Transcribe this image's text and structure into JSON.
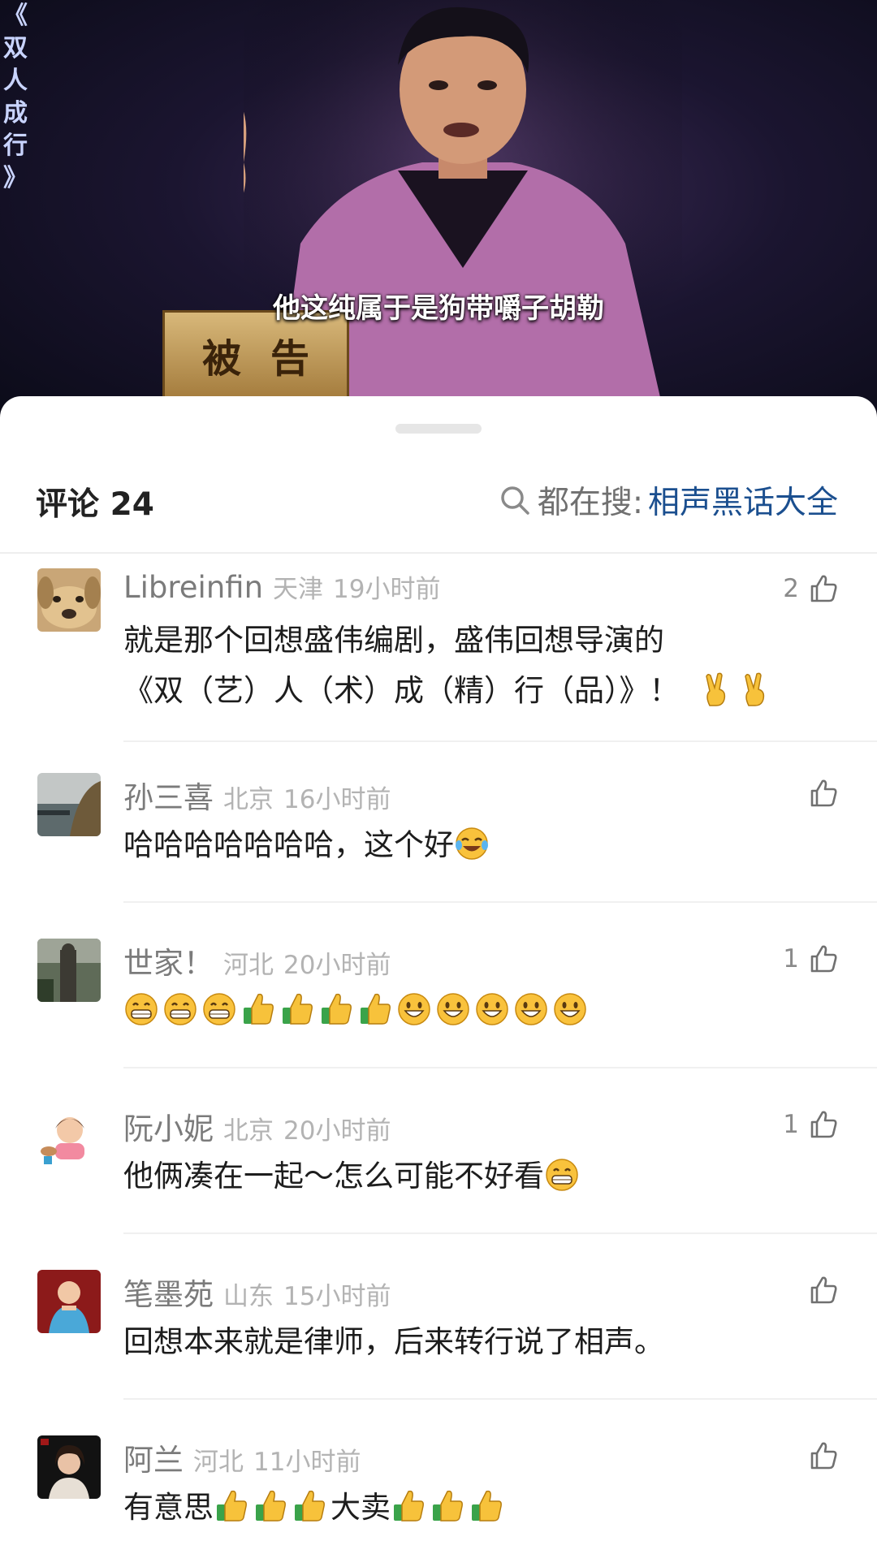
{
  "video": {
    "vertical_title": [
      "《",
      "双",
      "人",
      "成",
      "行",
      "》"
    ],
    "desk_sign": "被告",
    "subtitle": "他这纯属于是狗带嚼子胡勒"
  },
  "sheet": {
    "title": "评论 24",
    "search_prefix": "都在搜:",
    "search_keyword": "相声黑话大全"
  },
  "comments": [
    {
      "user": "Libreinfin",
      "location": "天津",
      "time": "19小时前",
      "likes": "2",
      "lines": [
        "就是那个回想盛伟编剧，盛伟回想导演的",
        "《双（艺）人（术）成（精）行（品）》！"
      ],
      "emojis": [
        "victory",
        "victory"
      ]
    },
    {
      "user": "孙三喜",
      "location": "北京",
      "time": "16小时前",
      "likes": "",
      "lines": [
        "哈哈哈哈哈哈哈，这个好"
      ],
      "emojis": [
        "tears-of-joy"
      ]
    },
    {
      "user": "世家！",
      "location": "河北",
      "time": "20小时前",
      "likes": "1",
      "lines": [
        ""
      ],
      "emojis": [
        "grin",
        "grin",
        "grin",
        "thumbs-up",
        "thumbs-up",
        "thumbs-up",
        "thumbs-up",
        "smile",
        "smile",
        "smile",
        "smile",
        "smile"
      ]
    },
    {
      "user": "阮小妮",
      "location": "北京",
      "time": "20小时前",
      "likes": "1",
      "lines": [
        "他俩凑在一起～怎么可能不好看"
      ],
      "emojis": [
        "grin"
      ]
    },
    {
      "user": "笔墨苑",
      "location": "山东",
      "time": "15小时前",
      "likes": "",
      "lines": [
        "回想本来就是律师，后来转行说了相声。"
      ],
      "emojis": []
    },
    {
      "user": "阿兰",
      "location": "河北",
      "time": "11小时前",
      "likes": "",
      "lines": [
        "有意思",
        "大卖"
      ],
      "emojis": [
        "thumbs-up",
        "thumbs-up",
        "thumbs-up",
        "thumbs-up",
        "thumbs-up",
        "thumbs-up"
      ]
    }
  ],
  "colors": {
    "keyword": "#1b4f8f",
    "username": "#7b7b7b",
    "meta": "#b3b3b3"
  }
}
